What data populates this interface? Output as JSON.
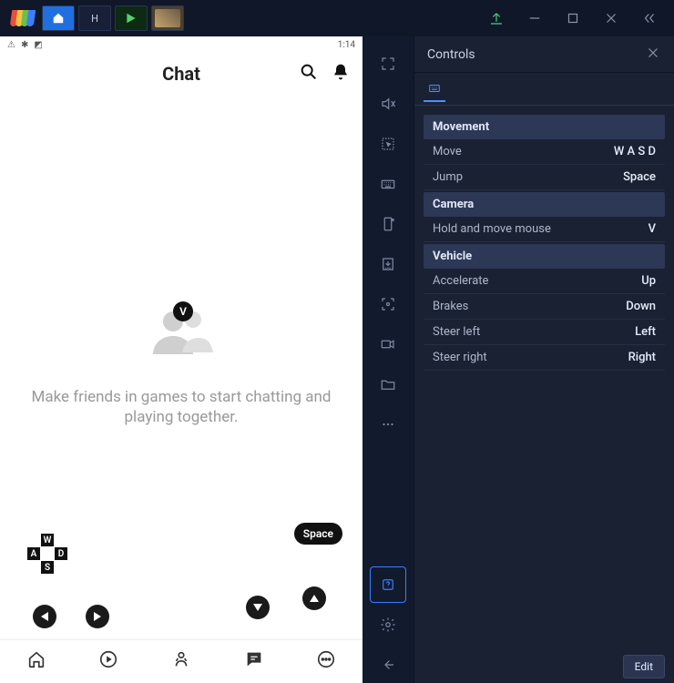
{
  "titlebar": {
    "tabs": [
      "BlueStacks",
      "Home",
      "Play Store",
      "Game"
    ]
  },
  "statusbar": {
    "time": "1:14"
  },
  "app": {
    "title": "Chat",
    "empty_message": "Make friends in games to start chatting and playing together."
  },
  "overlay": {
    "keys": {
      "w": "W",
      "a": "A",
      "s": "S",
      "d": "D"
    },
    "space": "Space",
    "v": "V"
  },
  "panel": {
    "title": "Controls",
    "sections": [
      {
        "name": "Movement",
        "rows": [
          {
            "label": "Move",
            "value": "W A S D"
          },
          {
            "label": "Jump",
            "value": "Space"
          }
        ]
      },
      {
        "name": "Camera",
        "rows": [
          {
            "label": "Hold and move mouse",
            "value": "V"
          }
        ]
      },
      {
        "name": "Vehicle",
        "rows": [
          {
            "label": "Accelerate",
            "value": "Up"
          },
          {
            "label": "Brakes",
            "value": "Down"
          },
          {
            "label": "Steer left",
            "value": "Left"
          },
          {
            "label": "Steer right",
            "value": "Right"
          }
        ]
      }
    ],
    "edit_label": "Edit"
  }
}
